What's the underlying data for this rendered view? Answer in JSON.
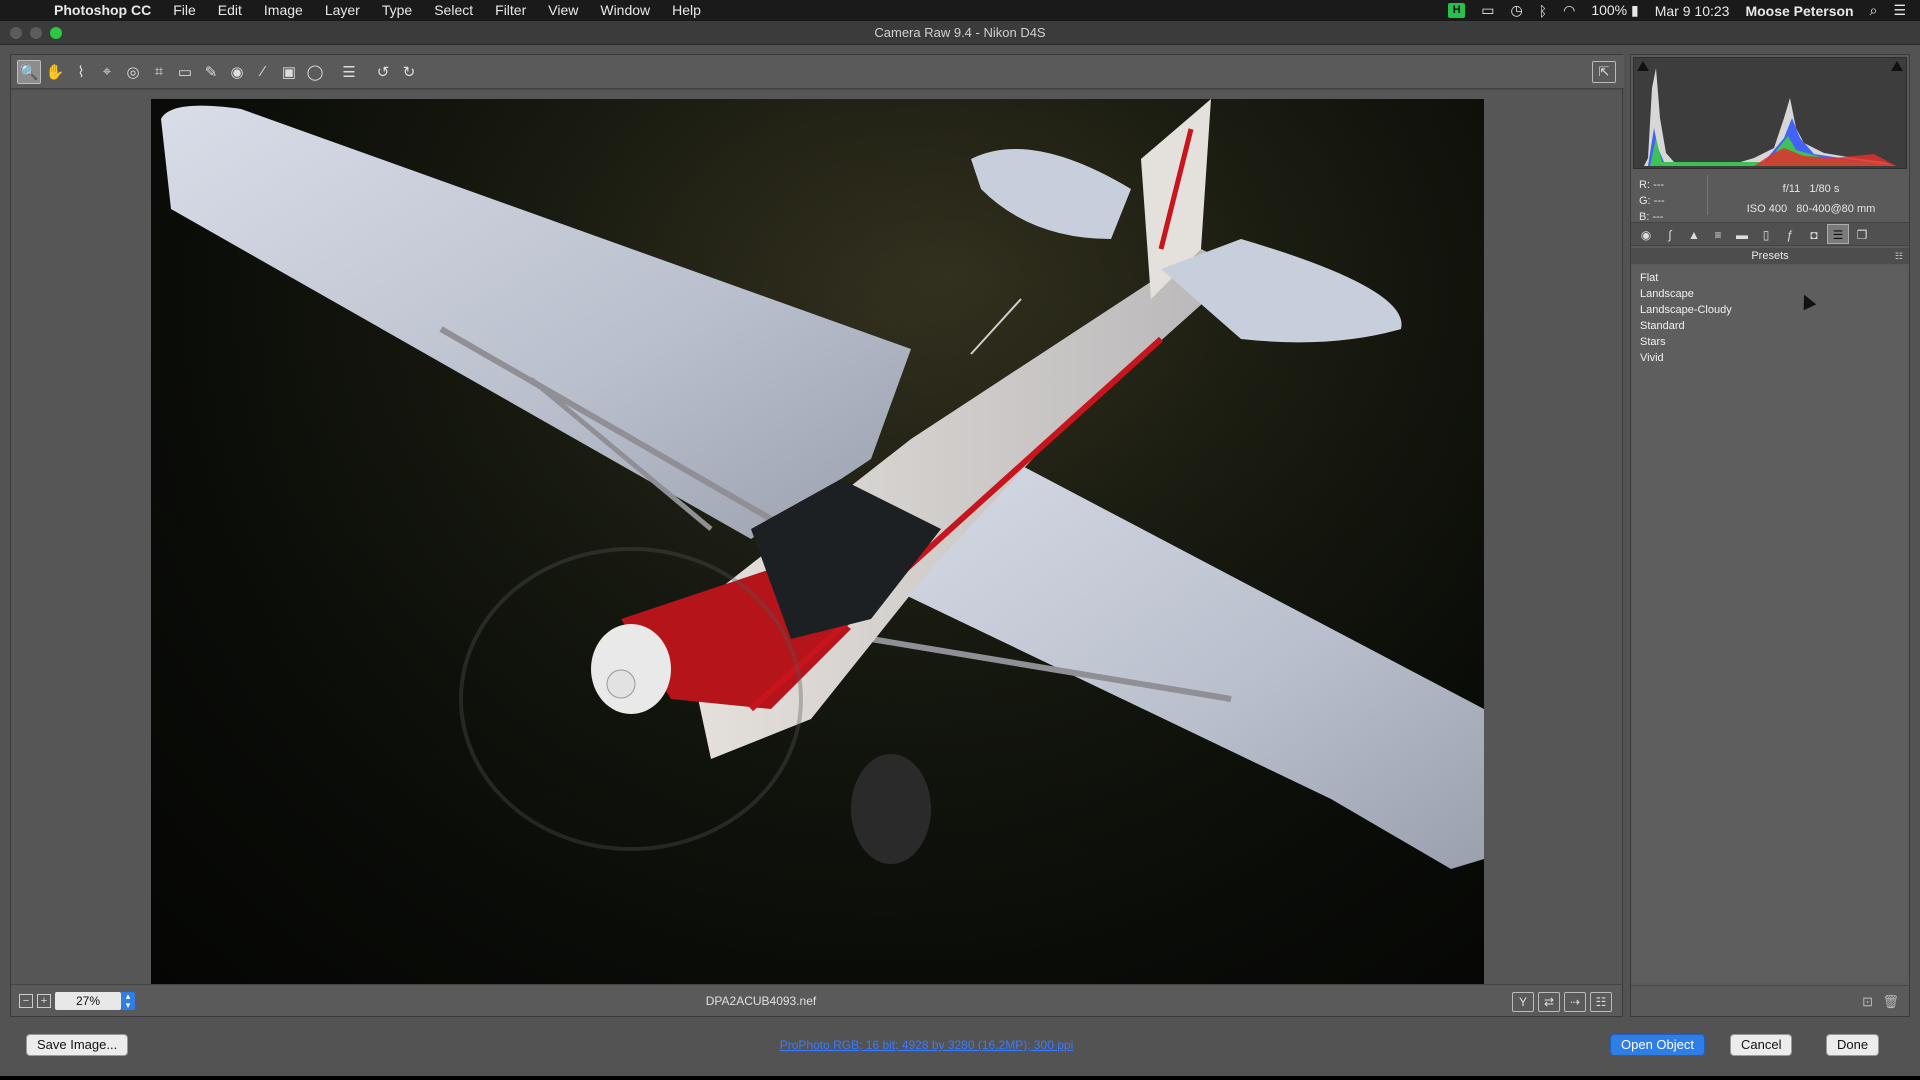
{
  "menubar": {
    "app_name": "Photoshop CC",
    "menus": [
      "File",
      "Edit",
      "Image",
      "Layer",
      "Type",
      "Select",
      "Filter",
      "View",
      "Window",
      "Help"
    ],
    "battery": "100%",
    "clock": "Mar 9 10:23",
    "user": "Moose Peterson"
  },
  "window": {
    "title": "Camera Raw 9.4  -  Nikon D4S"
  },
  "toolbar": {
    "tools": [
      {
        "name": "zoom-tool",
        "glyph": "🔍",
        "active": true
      },
      {
        "name": "hand-tool",
        "glyph": "✋",
        "active": false
      },
      {
        "name": "white-balance-tool",
        "glyph": "⌇",
        "active": false
      },
      {
        "name": "color-sampler-tool",
        "glyph": "⌖",
        "active": false
      },
      {
        "name": "targeted-adjustment-tool",
        "glyph": "◎",
        "active": false
      },
      {
        "name": "crop-tool",
        "glyph": "⌗",
        "active": false
      },
      {
        "name": "straighten-tool",
        "glyph": "▭",
        "active": false
      },
      {
        "name": "spot-removal-tool",
        "glyph": "✎",
        "active": false
      },
      {
        "name": "red-eye-tool",
        "glyph": "◉",
        "active": false
      },
      {
        "name": "adjustment-brush-tool",
        "glyph": "⁄",
        "active": false
      },
      {
        "name": "graduated-filter-tool",
        "glyph": "▣",
        "active": false
      },
      {
        "name": "radial-filter-tool",
        "glyph": "◯",
        "active": false
      },
      {
        "name": "preferences-tool",
        "glyph": "☰",
        "active": false
      },
      {
        "name": "rotate-left-tool",
        "glyph": "↺",
        "active": false
      },
      {
        "name": "rotate-right-tool",
        "glyph": "↻",
        "active": false
      }
    ]
  },
  "bottombar": {
    "zoom": "27%",
    "filename": "DPA2ACUB4093.nef"
  },
  "readout": {
    "r_label": "R:",
    "r_value": "---",
    "g_label": "G:",
    "g_value": "---",
    "b_label": "B:",
    "b_value": "---",
    "aperture": "f/11",
    "shutter": "1/80 s",
    "iso": "ISO 400",
    "lens": "80-400@80 mm"
  },
  "presets": {
    "header": "Presets",
    "items": [
      "Flat",
      "Landscape",
      "Landscape-Cloudy",
      "Standard",
      "Stars",
      "Vivid"
    ]
  },
  "footer": {
    "save_label": "Save Image...",
    "workflow": "ProPhoto RGB; 16 bit; 4928 by 3280 (16.2MP); 300 ppi",
    "open_label": "Open Object",
    "cancel_label": "Cancel",
    "done_label": "Done"
  },
  "colors": {
    "accent": "#2f7ee6",
    "histogram_red": "#e0302a",
    "histogram_green": "#3bd43a",
    "histogram_blue": "#2a4cff",
    "airplane_stripe": "#c8141c"
  }
}
